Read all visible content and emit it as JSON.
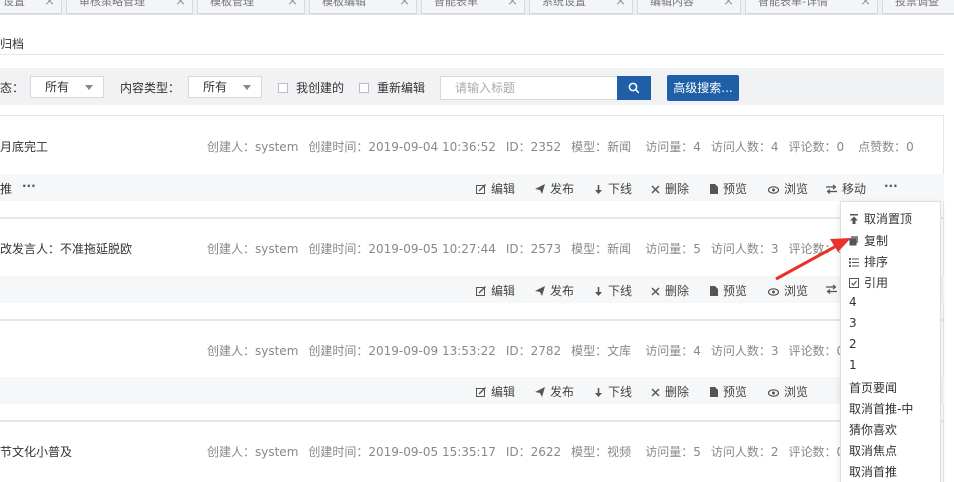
{
  "tabs": [
    {
      "label": "设置"
    },
    {
      "label": "审核策略管理"
    },
    {
      "label": "模板管理"
    },
    {
      "label": "模板编辑"
    },
    {
      "label": "智能表单"
    },
    {
      "label": "系统设置"
    },
    {
      "label": "编辑内容"
    },
    {
      "label": "智能表单-详情"
    },
    {
      "label": "投票调查"
    }
  ],
  "breadcrumb": "归档",
  "filters": {
    "status_label": "态：",
    "status_value": "所有",
    "content_type_label": "内容类型：",
    "content_type_value": "所有",
    "my_created_label": "我创建的",
    "reedit_label": "重新编辑",
    "search_placeholder": "请输入标题",
    "advanced_search_label": "高级搜索..."
  },
  "actions": {
    "edit": "编辑",
    "publish": "发布",
    "offline": "下线",
    "delete": "删除",
    "preview": "预览",
    "browse": "浏览",
    "move": "移动",
    "more": "···"
  },
  "cards": [
    {
      "title": "月底完工",
      "creator": "创建人：system",
      "created_time": "创建时间：2019-09-04 10:36:52",
      "id": "ID：2352",
      "model": "模型：新闻",
      "visits": "访问量：4",
      "visitors": "访问人数：4",
      "comments": "评论数：0",
      "likes": "点赞数：0",
      "tag": "推",
      "tag_more": "···"
    },
    {
      "title": "改发言人：不准拖延脱欧",
      "creator": "创建人：system",
      "created_time": "创建时间：2019-09-05 10:27:44",
      "id": "ID：2573",
      "model": "模型：新闻",
      "visits": "访问量：5",
      "visitors": "访问人数：3",
      "comments": "评论数：0"
    },
    {
      "title": "",
      "creator": "创建人：system",
      "created_time": "创建时间：2019-09-09 13:53:22",
      "id": "ID：2782",
      "model": "模型：文库",
      "visits": "访问量：4",
      "visitors": "访问人数：3",
      "comments": "评论数：0"
    },
    {
      "title": "节文化小普及",
      "creator": "创建人：system",
      "created_time": "创建时间：2019-09-05 15:35:17",
      "id": "ID：2622",
      "model": "模型：视频",
      "visits": "访问量：5",
      "visitors": "访问人数：2",
      "comments": "评论数：0"
    }
  ],
  "dropdown": {
    "items": [
      {
        "label": "取消置顶",
        "icon": "pin-icon"
      },
      {
        "label": "复制",
        "icon": "copy-icon"
      },
      {
        "label": "排序",
        "icon": "sort-icon"
      },
      {
        "label": "引用",
        "icon": "reference-icon"
      },
      {
        "label": "4"
      },
      {
        "label": "3"
      },
      {
        "label": "2"
      },
      {
        "label": "1"
      },
      {
        "label": "首页要闻"
      },
      {
        "label": "取消首推-中"
      },
      {
        "label": "猜你喜欢"
      },
      {
        "label": "取消焦点"
      },
      {
        "label": "取消首推"
      }
    ]
  },
  "colors": {
    "primary": "#1f5fa8",
    "annotation_arrow": "#e8312b",
    "filter_bg": "#f1f2f4",
    "footer_bg": "#f6f7f8"
  }
}
